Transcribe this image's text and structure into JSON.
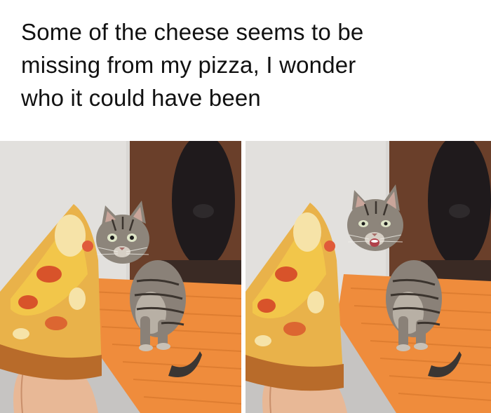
{
  "meme": {
    "caption_lines": [
      "Some of the cheese seems to be",
      "missing from my pizza, I wonder",
      "who it could have been"
    ]
  },
  "colors": {
    "background": "#ffffff",
    "text": "#111111",
    "blanket": "#ef8c3c",
    "cheese": "#f2c64a",
    "sauce": "#d8532a"
  },
  "panels": [
    {
      "name": "photo-kitten-eyeing-pizza",
      "kitten_mouth": "closed"
    },
    {
      "name": "photo-kitten-smiling-at-pizza",
      "kitten_mouth": "open"
    }
  ]
}
